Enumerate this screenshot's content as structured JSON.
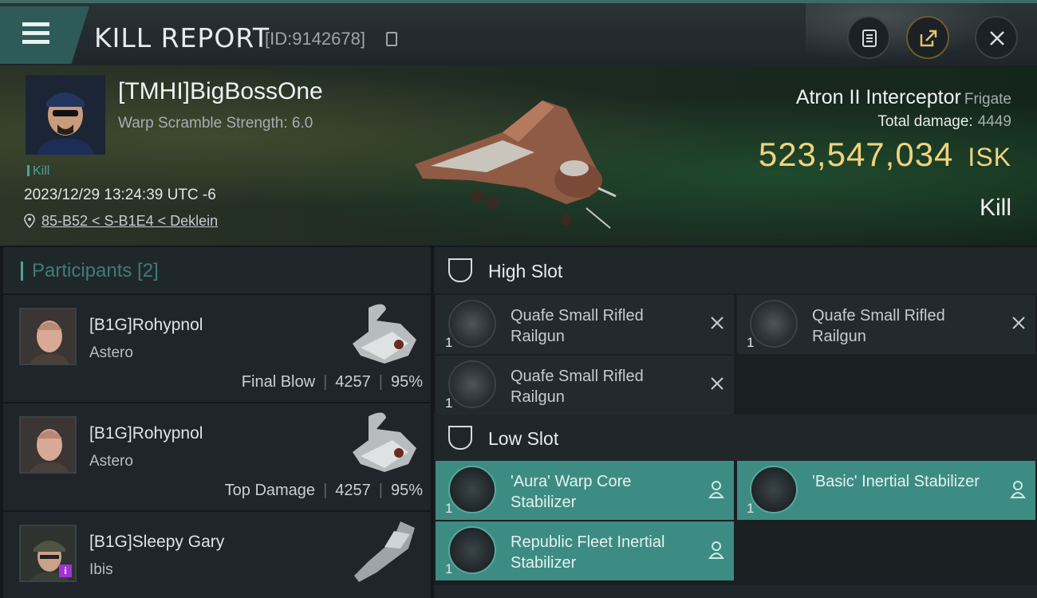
{
  "header": {
    "title": "KILL REPORT",
    "kill_id": "[ID:9142678]"
  },
  "victim": {
    "name": "[TMHI]BigBossOne",
    "warp_scramble": "Warp Scramble Strength: 6.0",
    "kill_tag": "Kill",
    "datetime": "2023/12/29 13:24:39 UTC -6",
    "location": "85-B52 < S-B1E4 < Deklein",
    "ship_name": "Atron II Interceptor",
    "ship_class": "Frigate",
    "total_damage_label": "Total damage:",
    "total_damage": "4449",
    "isk_value": "523,547,034",
    "isk_unit": "ISK",
    "result": "Kill"
  },
  "participants": {
    "label": "Participants [2]",
    "rows": [
      {
        "name": "[B1G]Rohypnol",
        "ship": "Astero",
        "role": "Final Blow",
        "damage": "4257",
        "percent": "95%"
      },
      {
        "name": "[B1G]Rohypnol",
        "ship": "Astero",
        "role": "Top Damage",
        "damage": "4257",
        "percent": "95%"
      },
      {
        "name": "[B1G]Sleepy Gary",
        "ship": "Ibis",
        "role": "",
        "damage": "",
        "percent": ""
      }
    ]
  },
  "slots": {
    "high": {
      "label": "High Slot",
      "modules": [
        {
          "qty": "1",
          "name": "Quafe Small Rifled Railgun",
          "status": "destroyed"
        },
        {
          "qty": "1",
          "name": "Quafe Small Rifled Railgun",
          "status": "destroyed"
        },
        {
          "qty": "1",
          "name": "Quafe Small Rifled Railgun",
          "status": "destroyed"
        }
      ]
    },
    "low": {
      "label": "Low Slot",
      "modules": [
        {
          "qty": "1",
          "name": "'Aura' Warp Core Stabilizer",
          "status": "dropped"
        },
        {
          "qty": "1",
          "name": "'Basic' Inertial Stabilizer",
          "status": "dropped"
        },
        {
          "qty": "1",
          "name": "Republic Fleet Inertial Stabilizer",
          "status": "dropped"
        }
      ]
    }
  },
  "colors": {
    "accent": "#4da39a",
    "isk": "#f1d37c",
    "fitted_module": "#3d8c84"
  },
  "icons": [
    "menu-icon",
    "copy-icon",
    "clipboard-icon",
    "share-icon",
    "close-icon",
    "location-pin-icon",
    "slot-shield-icon",
    "destroyed-x-icon",
    "dropped-person-icon"
  ]
}
